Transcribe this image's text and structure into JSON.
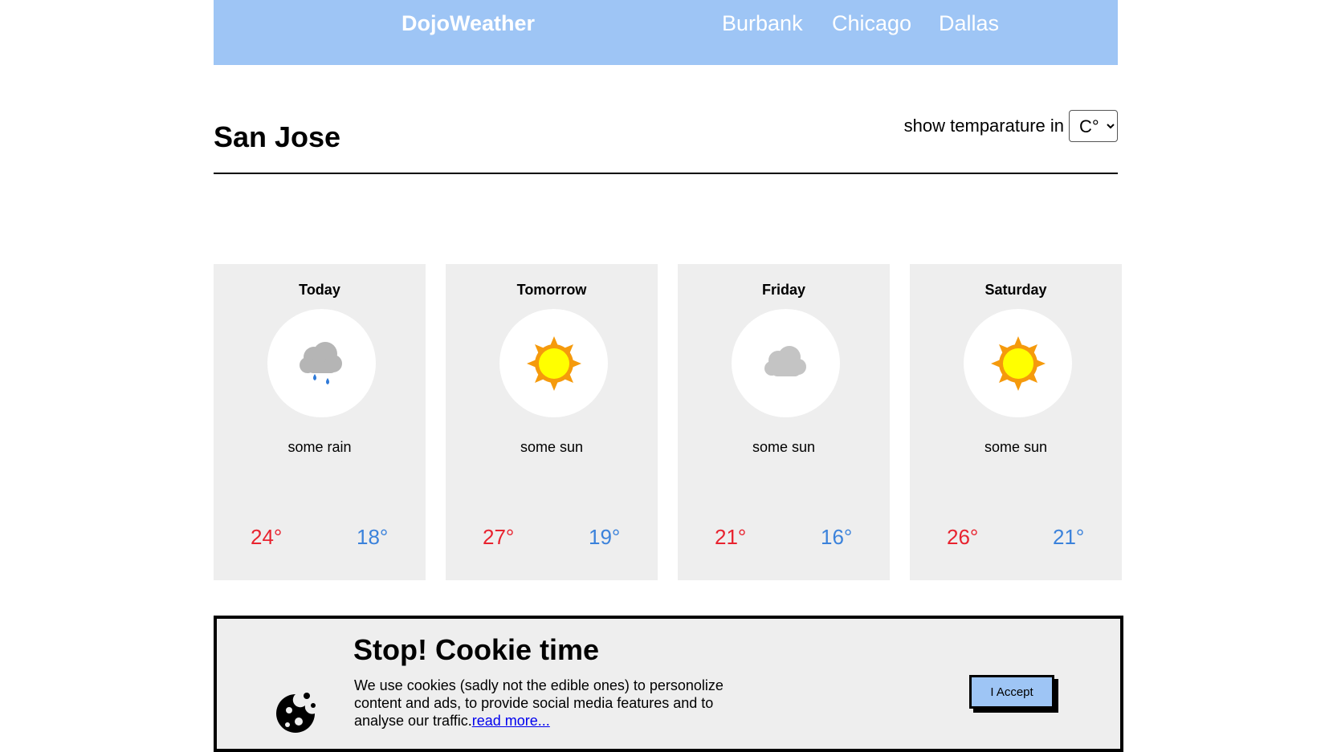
{
  "nav": {
    "brand": "DojoWeather",
    "links": [
      "Burbank",
      "Chicago",
      "Dallas"
    ]
  },
  "city": "San Jose",
  "unit_selector": {
    "label": "show temparature in",
    "selected": "C°"
  },
  "forecast": [
    {
      "day": "Today",
      "icon": "rain-cloud-icon",
      "description": "some rain",
      "high": "24°",
      "low": "18°"
    },
    {
      "day": "Tomorrow",
      "icon": "sun-icon",
      "description": "some sun",
      "high": "27°",
      "low": "19°"
    },
    {
      "day": "Friday",
      "icon": "cloud-icon",
      "description": "some sun",
      "high": "21°",
      "low": "16°"
    },
    {
      "day": "Saturday",
      "icon": "sun-icon",
      "description": "some sun",
      "high": "26°",
      "low": "21°"
    }
  ],
  "cookie": {
    "title": "Stop! Cookie time",
    "text": "We use cookies (sadly not the edible ones) to personolize content and ads, to provide social media features and to analyse our traffic.",
    "link": "read more...",
    "button": "I Accept",
    "icon": "cookie-icon"
  },
  "colors": {
    "nav_bg": "#9ec5f5",
    "high_temp": "#e8232f",
    "low_temp": "#3b82db",
    "card_bg": "#eeeeee"
  }
}
